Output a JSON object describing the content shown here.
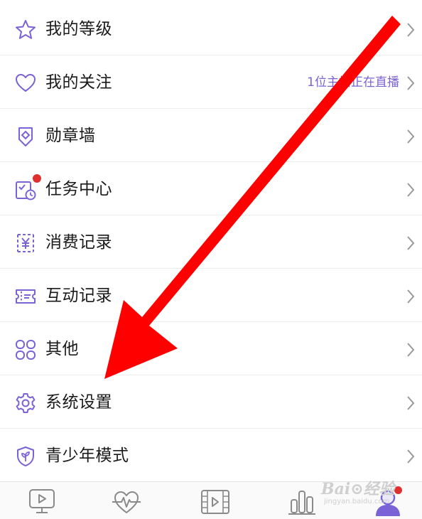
{
  "colors": {
    "accent": "#7a63d6",
    "badge": "#e02f2f",
    "annotation_arrow": "#ff0000"
  },
  "menu": {
    "items": [
      {
        "label": "我的等级",
        "icon": "star-icon",
        "detail": ""
      },
      {
        "label": "我的关注",
        "icon": "heart-icon",
        "detail": "1位主播正在直播"
      },
      {
        "label": "勋章墙",
        "icon": "medal-icon",
        "detail": ""
      },
      {
        "label": "任务中心",
        "icon": "task-clock-icon",
        "detail": "",
        "badge": true
      },
      {
        "label": "消费记录",
        "icon": "yen-receipt-icon",
        "detail": ""
      },
      {
        "label": "互动记录",
        "icon": "ticket-icon",
        "detail": ""
      },
      {
        "label": "其他",
        "icon": "four-petal-icon",
        "detail": ""
      },
      {
        "label": "系统设置",
        "icon": "gear-icon",
        "detail": ""
      },
      {
        "label": "青少年模式",
        "icon": "shield-sprout-icon",
        "detail": ""
      }
    ]
  },
  "tabbar": {
    "tabs": [
      {
        "icon": "play-monitor-icon",
        "active": false
      },
      {
        "icon": "heart-pulse-icon",
        "active": false
      },
      {
        "icon": "film-play-icon",
        "active": false
      },
      {
        "icon": "bar-chart-icon",
        "active": false
      },
      {
        "icon": "profile-icon",
        "active": true,
        "badge": true
      }
    ]
  },
  "watermark": {
    "logo": "Bai⊙经验",
    "url": "jingyan.baidu.com"
  }
}
